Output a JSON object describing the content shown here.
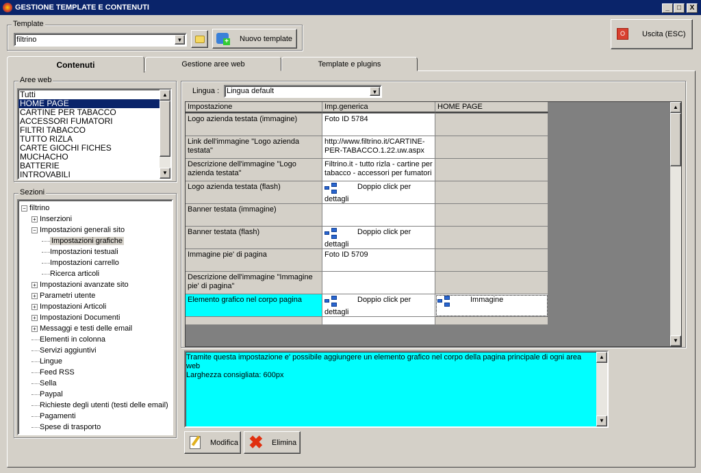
{
  "window": {
    "title": "GESTIONE TEMPLATE E CONTENUTI",
    "min": "_",
    "max": "□",
    "close": "X"
  },
  "template": {
    "group_label": "Template",
    "value": "filtrino",
    "new_label": "Nuovo template"
  },
  "exit_label": "Uscita (ESC)",
  "tabs": [
    {
      "label": "Contenuti"
    },
    {
      "label": "Gestione aree web"
    },
    {
      "label": "Template e plugins"
    }
  ],
  "aree_web": {
    "label": "Aree web",
    "items": [
      "Tutti",
      "HOME PAGE",
      "CARTINE PER TABACCO",
      "ACCESSORI  FUMATORI",
      "FILTRI TABACCO",
      "TUTTO RIZLA",
      "CARTE GIOCHI  FICHES",
      "MUCHACHO",
      "BATTERIE",
      "INTROVABILI"
    ],
    "selected": "HOME PAGE"
  },
  "sezioni": {
    "label": "Sezioni",
    "tree": [
      {
        "label": "filtrino",
        "level": 0,
        "toggle": "−"
      },
      {
        "label": "Inserzioni",
        "level": 1,
        "toggle": "+"
      },
      {
        "label": "Impostazioni generali sito",
        "level": 1,
        "toggle": "−"
      },
      {
        "label": "Impostazioni grafiche",
        "level": 2,
        "selected": true
      },
      {
        "label": "Impostazioni testuali",
        "level": 2
      },
      {
        "label": "Impostazioni carrello",
        "level": 2
      },
      {
        "label": "Ricerca articoli",
        "level": 2
      },
      {
        "label": "Impostazioni avanzate sito",
        "level": 1,
        "toggle": "+"
      },
      {
        "label": "Parametri utente",
        "level": 1,
        "toggle": "+"
      },
      {
        "label": "Impostazioni Articoli",
        "level": 1,
        "toggle": "+"
      },
      {
        "label": "Impostazioni Documenti",
        "level": 1,
        "toggle": "+"
      },
      {
        "label": "Messaggi e testi delle email",
        "level": 1,
        "toggle": "+"
      },
      {
        "label": "Elementi in colonna",
        "level": 1
      },
      {
        "label": "Servizi aggiuntivi",
        "level": 1
      },
      {
        "label": "Lingue",
        "level": 1
      },
      {
        "label": "Feed RSS",
        "level": 1
      },
      {
        "label": "Sella",
        "level": 1
      },
      {
        "label": "Paypal",
        "level": 1
      },
      {
        "label": "Richieste degli utenti (testi delle email)",
        "level": 1
      },
      {
        "label": "Pagamenti",
        "level": 1
      },
      {
        "label": "Spese di trasporto",
        "level": 1
      }
    ]
  },
  "lingua": {
    "label": "Lingua :",
    "value": "Lingua default"
  },
  "grid": {
    "columns": [
      "Impostazione",
      "Imp.generica",
      "HOME PAGE"
    ],
    "rows": [
      [
        "Logo azienda testata (immagine)",
        "Foto ID 5784",
        ""
      ],
      [
        "Link dell'immagine \"Logo azienda testata\"",
        "http://www.filtrino.it/CARTINE-PER-TABACCO.1.22.uw.aspx",
        ""
      ],
      [
        "Descrizione dell'immagine \"Logo azienda testata\"",
        "Filtrino.it - tutto rizla - cartine per tabacco - accessori per fumatori",
        ""
      ],
      [
        "Logo azienda testata (flash)",
        "@Doppio click per dettagli",
        ""
      ],
      [
        "Banner testata (immagine)",
        "",
        ""
      ],
      [
        "Banner testata (flash)",
        "@Doppio click per dettagli",
        ""
      ],
      [
        "Immagine pie' di pagina",
        "Foto ID 5709",
        ""
      ],
      [
        "Descrizione dell'immagine \"Immagine pie' di pagina\"",
        "",
        ""
      ],
      [
        "Elemento grafico nel corpo pagina",
        "@Doppio click per dettagli",
        "@Immagine"
      ],
      [
        "",
        "",
        ""
      ]
    ],
    "selected_row": 8,
    "highlight_color": "#00ffff"
  },
  "description": "Tramite questa impostazione e' possibile aggiungere un elemento grafico nel corpo della pagina principale di ogni area web\nLarghezza consigliata: 600px",
  "buttons": {
    "modifica": "Modifica",
    "elimina": "Elimina"
  }
}
